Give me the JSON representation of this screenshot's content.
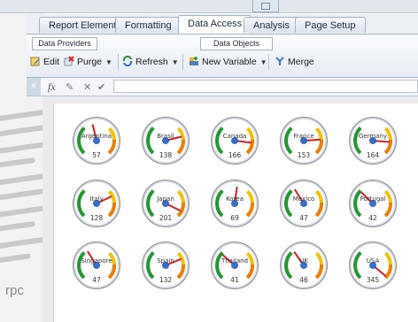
{
  "window": {
    "background_fragment": "rpc"
  },
  "tabs": [
    {
      "label": "Report Elements",
      "active": false
    },
    {
      "label": "Formatting",
      "active": false
    },
    {
      "label": "Data Access",
      "active": true
    },
    {
      "label": "Analysis",
      "active": false
    },
    {
      "label": "Page Setup",
      "active": false
    }
  ],
  "groups": {
    "data_providers": "Data Providers",
    "data_objects": "Data Objects"
  },
  "toolbar": {
    "edit": "Edit",
    "purge": "Purge",
    "refresh": "Refresh",
    "new_variable": "New Variable",
    "merge": "Merge"
  },
  "formula_bar": {
    "value": ""
  },
  "gauges": [
    {
      "name": "Argentina",
      "value": "57",
      "needle": 0.45
    },
    {
      "name": "Brasil",
      "value": "138",
      "needle": 0.78
    },
    {
      "name": "Canada",
      "value": "166",
      "needle": 0.86
    },
    {
      "name": "France",
      "value": "153",
      "needle": 0.82
    },
    {
      "name": "Germany",
      "value": "164",
      "needle": 0.85
    },
    {
      "name": "Italy",
      "value": "128",
      "needle": 0.74
    },
    {
      "name": "Japan",
      "value": "201",
      "needle": 0.93
    },
    {
      "name": "Korea",
      "value": "69",
      "needle": 0.53
    },
    {
      "name": "Mexico",
      "value": "47",
      "needle": 0.38
    },
    {
      "name": "Portugal",
      "value": "42",
      "needle": 0.33
    },
    {
      "name": "Singapore",
      "value": "47",
      "needle": 0.38
    },
    {
      "name": "Spain",
      "value": "132",
      "needle": 0.75
    },
    {
      "name": "Thailand",
      "value": "41",
      "needle": 0.32
    },
    {
      "name": "UK",
      "value": "46",
      "needle": 0.37
    },
    {
      "name": "USA",
      "value": "345",
      "needle": 0.98
    }
  ],
  "colors": {
    "gauge_green": "#1e9a2e",
    "gauge_yellow": "#f2c200",
    "gauge_orange": "#ef7d00",
    "needle": "#d62020",
    "hub": "#2f6fd6"
  }
}
